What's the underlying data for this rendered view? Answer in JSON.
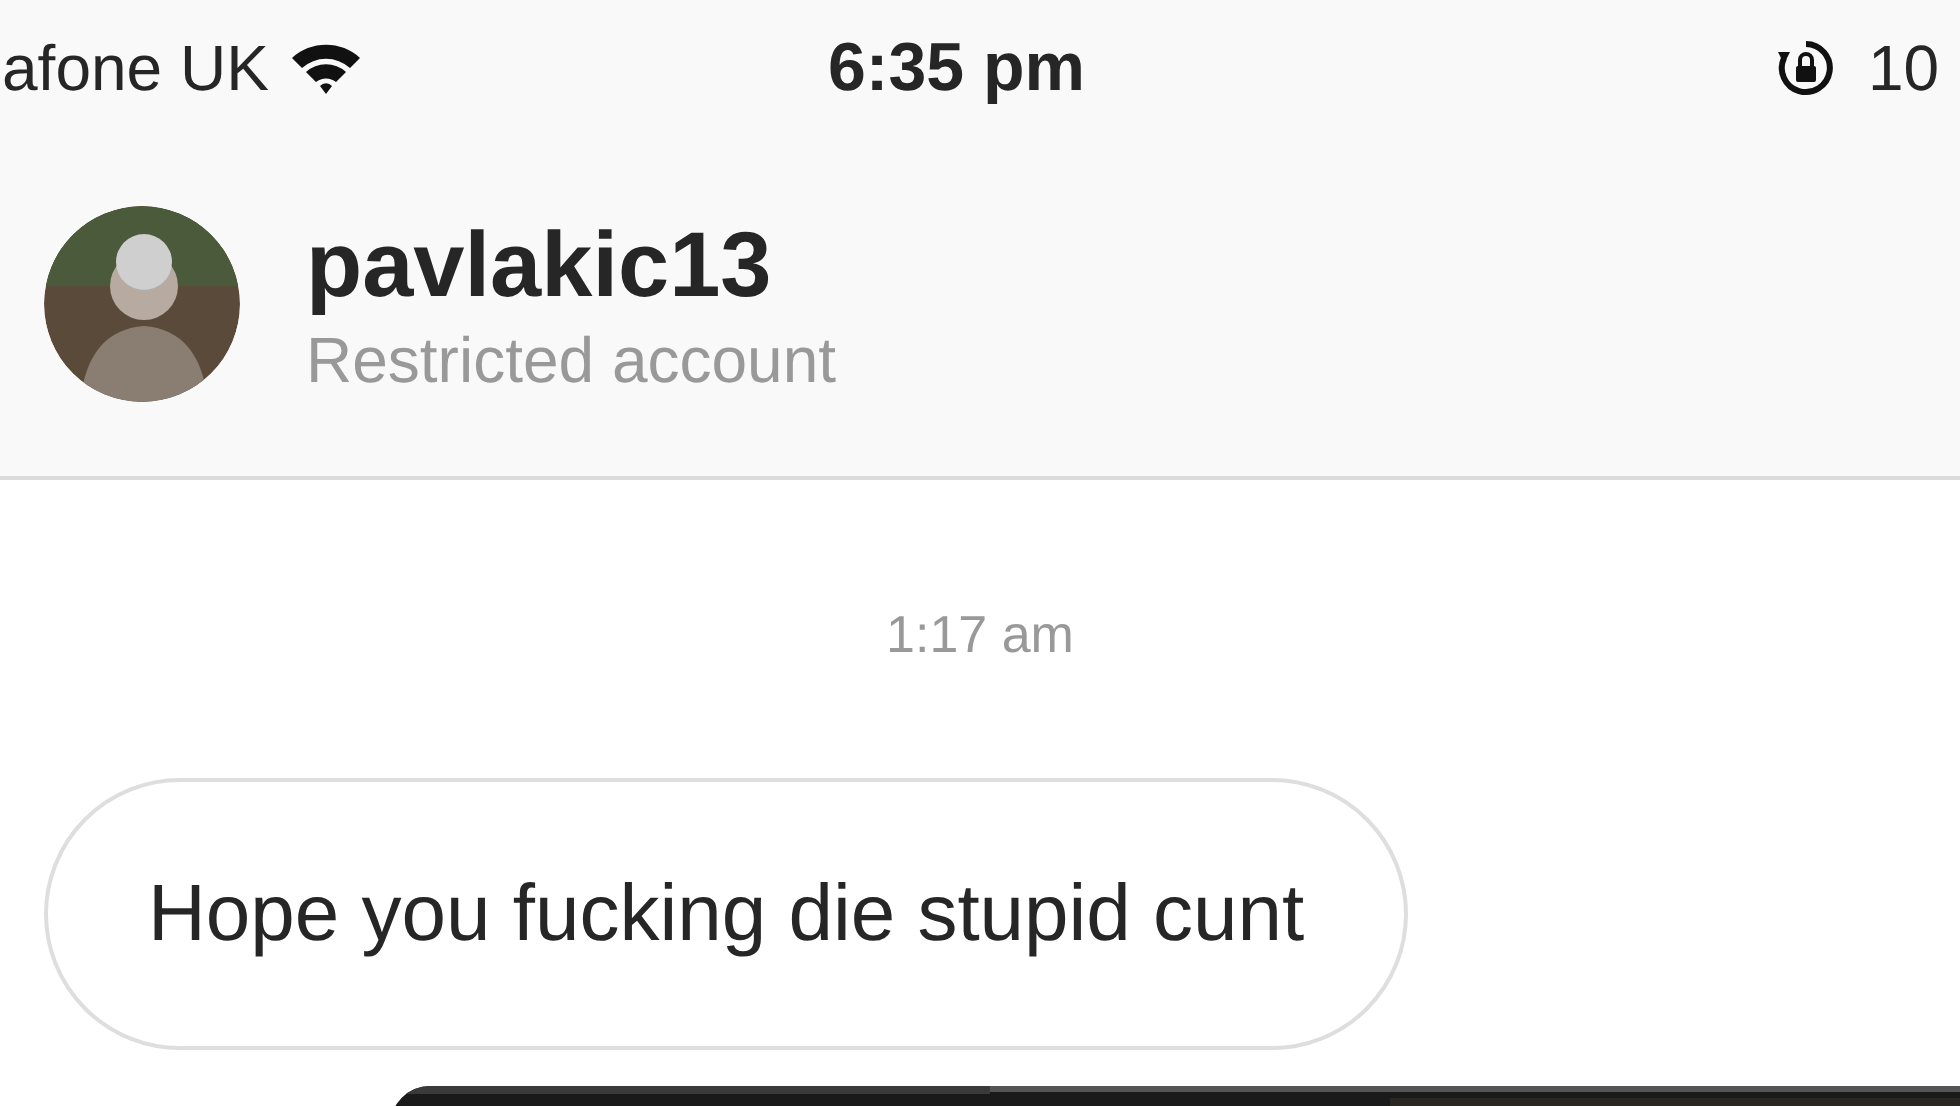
{
  "status_bar": {
    "carrier": "afone UK",
    "time": "6:35 pm",
    "battery": "10"
  },
  "header": {
    "username": "pavlakic13",
    "subtitle": "Restricted account"
  },
  "messages": [
    {
      "kind": "timestamp",
      "text": "1:17 am"
    },
    {
      "kind": "text",
      "text": "Hope you fucking die stupid cunt"
    },
    {
      "kind": "picture"
    }
  ]
}
